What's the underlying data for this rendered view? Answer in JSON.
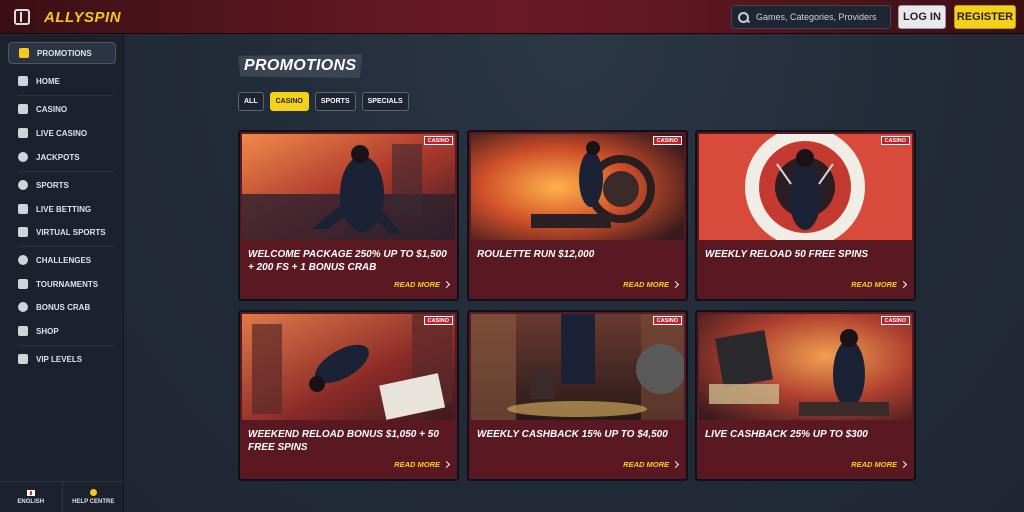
{
  "brand": {
    "logo_text": "ALLYSPIN",
    "accent": "#f4c81d"
  },
  "header": {
    "search_placeholder": "Games, Categories, Providers",
    "login_label": "LOG IN",
    "register_label": "REGISTER"
  },
  "sidebar": {
    "items": [
      {
        "label": "PROMOTIONS",
        "icon": "gift-icon",
        "active": true
      },
      {
        "label": "HOME",
        "icon": "home-icon"
      },
      {
        "label": "CASINO",
        "icon": "casino-icon"
      },
      {
        "label": "LIVE CASINO",
        "icon": "live-casino-icon"
      },
      {
        "label": "JACKPOTS",
        "icon": "jackpots-icon"
      },
      {
        "label": "SPORTS",
        "icon": "sports-icon"
      },
      {
        "label": "LIVE BETTING",
        "icon": "live-betting-icon"
      },
      {
        "label": "VIRTUAL SPORTS",
        "icon": "virtual-sports-icon"
      },
      {
        "label": "CHALLENGES",
        "icon": "challenges-icon"
      },
      {
        "label": "TOURNAMENTS",
        "icon": "tournaments-icon"
      },
      {
        "label": "BONUS CRAB",
        "icon": "bonus-crab-icon"
      },
      {
        "label": "SHOP",
        "icon": "shop-icon"
      },
      {
        "label": "VIP LEVELS",
        "icon": "vip-icon"
      }
    ],
    "footer": {
      "language": "ENGLISH",
      "help": "HELP CENTRE"
    }
  },
  "main": {
    "title": "PROMOTIONS",
    "filters": [
      {
        "label": "ALL",
        "active": false
      },
      {
        "label": "CASINO",
        "active": true
      },
      {
        "label": "SPORTS",
        "active": false
      },
      {
        "label": "SPECIALS",
        "active": false
      }
    ],
    "cards": [
      {
        "badge": "CASINO",
        "title": "WELCOME PACKAGE 250% UP TO $1,500 + 200 FS + 1 BONUS CRAB",
        "cta": "READ MORE"
      },
      {
        "badge": "CASINO",
        "title": "ROULETTE RUN $12,000",
        "cta": "READ MORE"
      },
      {
        "badge": "CASINO",
        "title": "WEEKLY RELOAD 50 FREE SPINS",
        "cta": "READ MORE"
      },
      {
        "badge": "CASINO",
        "title": "WEEKEND RELOAD BONUS $1,050 + 50 FREE SPINS",
        "cta": "READ MORE"
      },
      {
        "badge": "CASINO",
        "title": "WEEKLY CASHBACK 15% UP TO $4,500",
        "cta": "READ MORE"
      },
      {
        "badge": "CASINO",
        "title": "LIVE CASHBACK 25% UP TO $300",
        "cta": "READ MORE"
      }
    ]
  }
}
